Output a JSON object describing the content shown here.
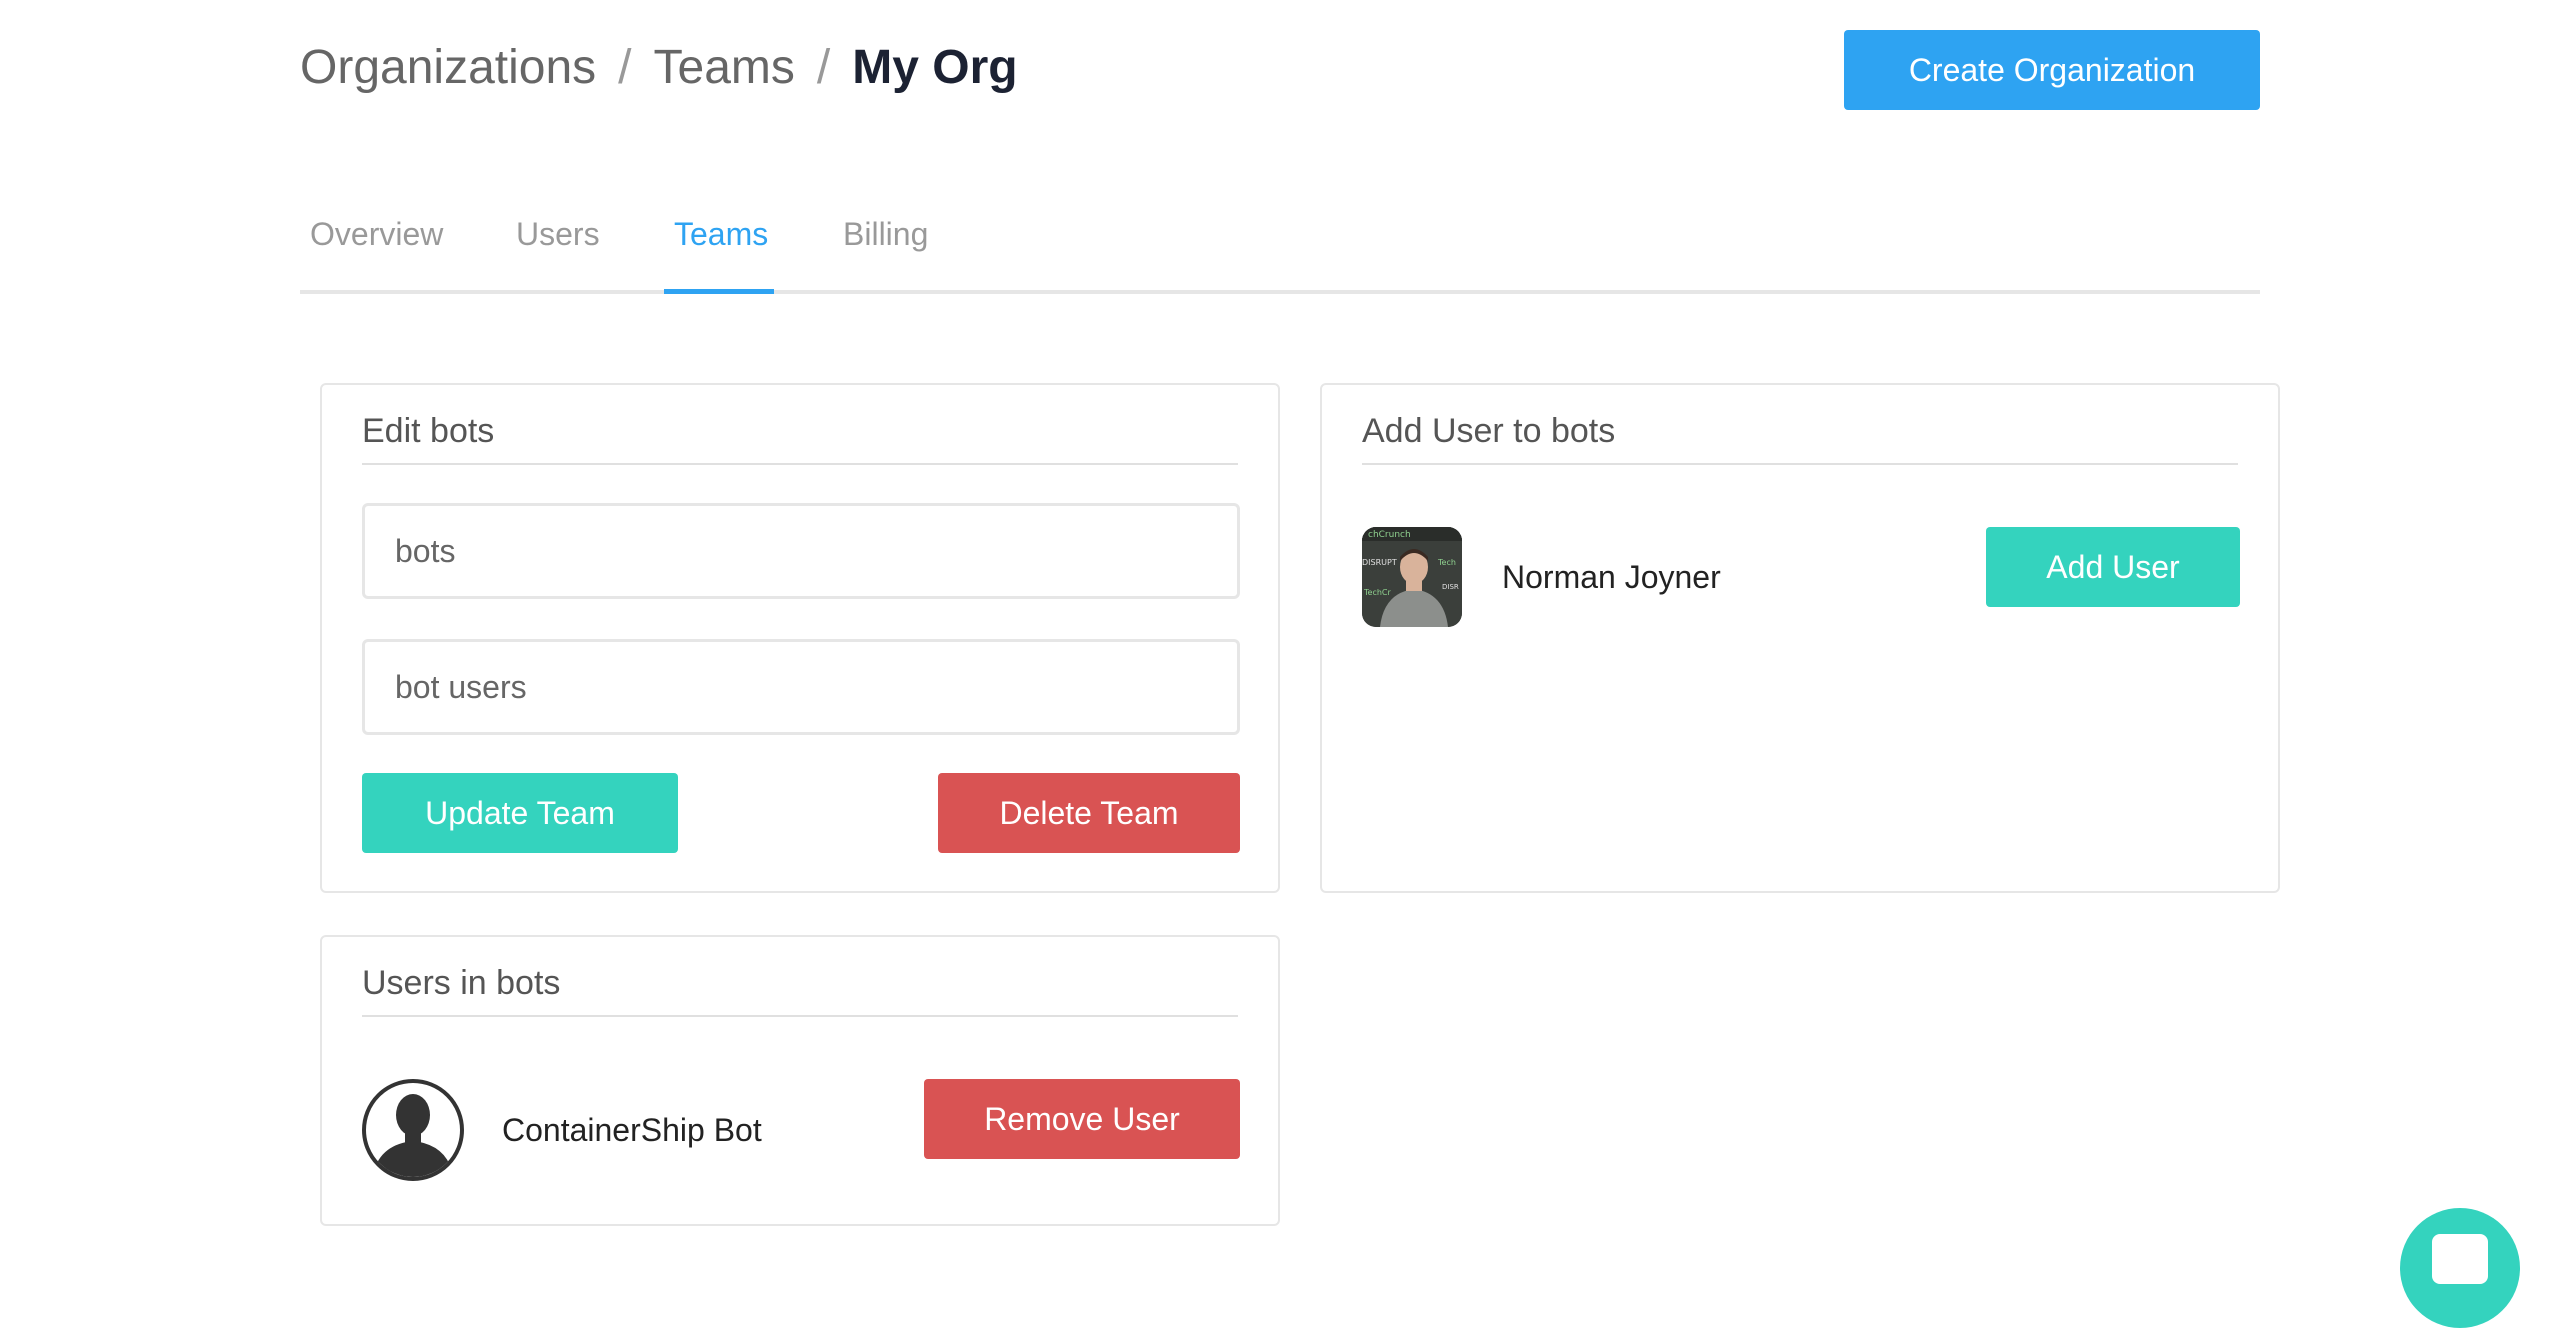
{
  "breadcrumb": {
    "items": [
      "Organizations",
      "Teams"
    ],
    "current": "My Org",
    "separator": "/"
  },
  "header": {
    "create_org_label": "Create Organization"
  },
  "tabs": [
    {
      "label": "Overview",
      "active": false
    },
    {
      "label": "Users",
      "active": false
    },
    {
      "label": "Teams",
      "active": true
    },
    {
      "label": "Billing",
      "active": false
    }
  ],
  "edit_team": {
    "title": "Edit bots",
    "name_value": "bots",
    "description_value": "bot users",
    "update_label": "Update Team",
    "delete_label": "Delete Team"
  },
  "add_user": {
    "title": "Add User to bots",
    "user_name": "Norman Joyner",
    "add_label": "Add User"
  },
  "team_users": {
    "title": "Users in bots",
    "user_name": "ContainerShip Bot",
    "remove_label": "Remove User"
  },
  "colors": {
    "primary_blue": "#2ea3f2",
    "success_teal": "#34d3be",
    "danger_red": "#d95353"
  },
  "icons": {
    "chat": "chat-icon",
    "default_avatar": "user-silhouette-icon"
  }
}
